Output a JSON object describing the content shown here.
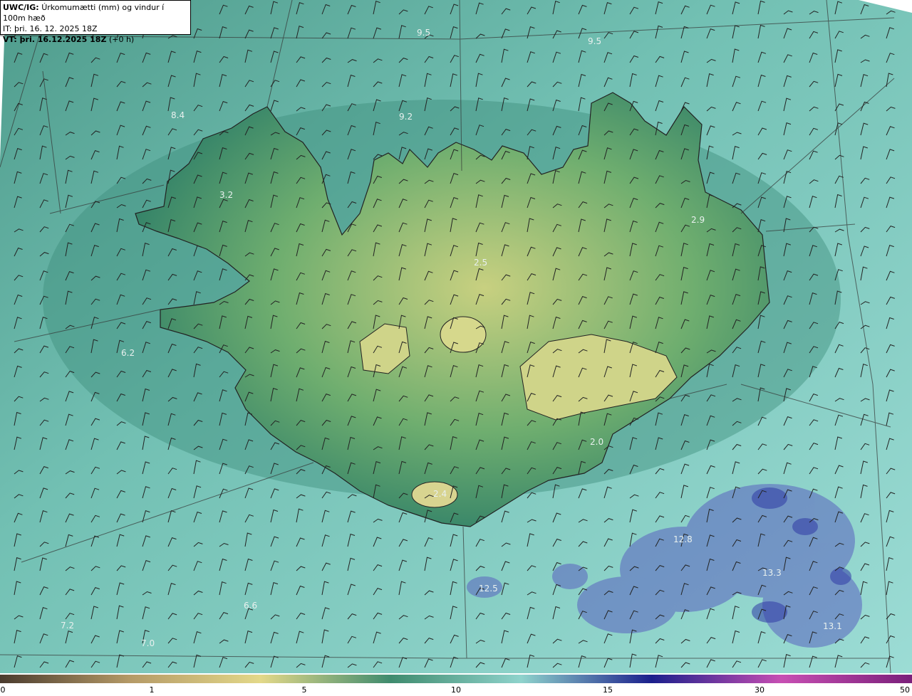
{
  "header": {
    "model_label": "UWC/IG:",
    "title_text": "Úrkomumætti (mm) og vindur í 100m hæð",
    "it_line": "IT: þri. 16. 12. 2025 18Z",
    "vt_label": "VT: þri. 16.12.2025 18Z",
    "vt_offset": "(+0 h)"
  },
  "map": {
    "value_labels": [
      {
        "text": "9.5",
        "pos": "north"
      },
      {
        "text": "9.5",
        "pos": "north-east"
      },
      {
        "text": "8.4",
        "pos": "north-west"
      },
      {
        "text": "9.2",
        "pos": "north"
      },
      {
        "text": "3.2",
        "pos": "westfjords"
      },
      {
        "text": "2.9",
        "pos": "east"
      },
      {
        "text": "2.5",
        "pos": "interior"
      },
      {
        "text": "6.2",
        "pos": "west-sea"
      },
      {
        "text": "2.0",
        "pos": "south-east"
      },
      {
        "text": "2.4",
        "pos": "south"
      },
      {
        "text": "12.8",
        "pos": "south-east-sea"
      },
      {
        "text": "13.3",
        "pos": "south-east-sea"
      },
      {
        "text": "12.5",
        "pos": "south-sea"
      },
      {
        "text": "7.2",
        "pos": "south-west-sea"
      },
      {
        "text": "7.0",
        "pos": "south-west-sea"
      },
      {
        "text": "6.6",
        "pos": "south-west-sea"
      },
      {
        "text": "13.1",
        "pos": "south-east-sea"
      }
    ],
    "colors": {
      "sea": "#8fd3cc",
      "sea_dark": "#5fae9f",
      "land_low": "#2f8a6e",
      "land_high": "#c4cf7e",
      "heavy_precip": "#5a62c0",
      "contour": "#222222"
    }
  },
  "colorbar": {
    "ticks": [
      "0",
      "1",
      "5",
      "10",
      "15",
      "30",
      "50"
    ],
    "stops": [
      "#4a3b2e",
      "#b59a67",
      "#e3d889",
      "#3f8b6e",
      "#8fd3cc",
      "#1b1f8c",
      "#c74fb3",
      "#7a1f7a"
    ]
  }
}
